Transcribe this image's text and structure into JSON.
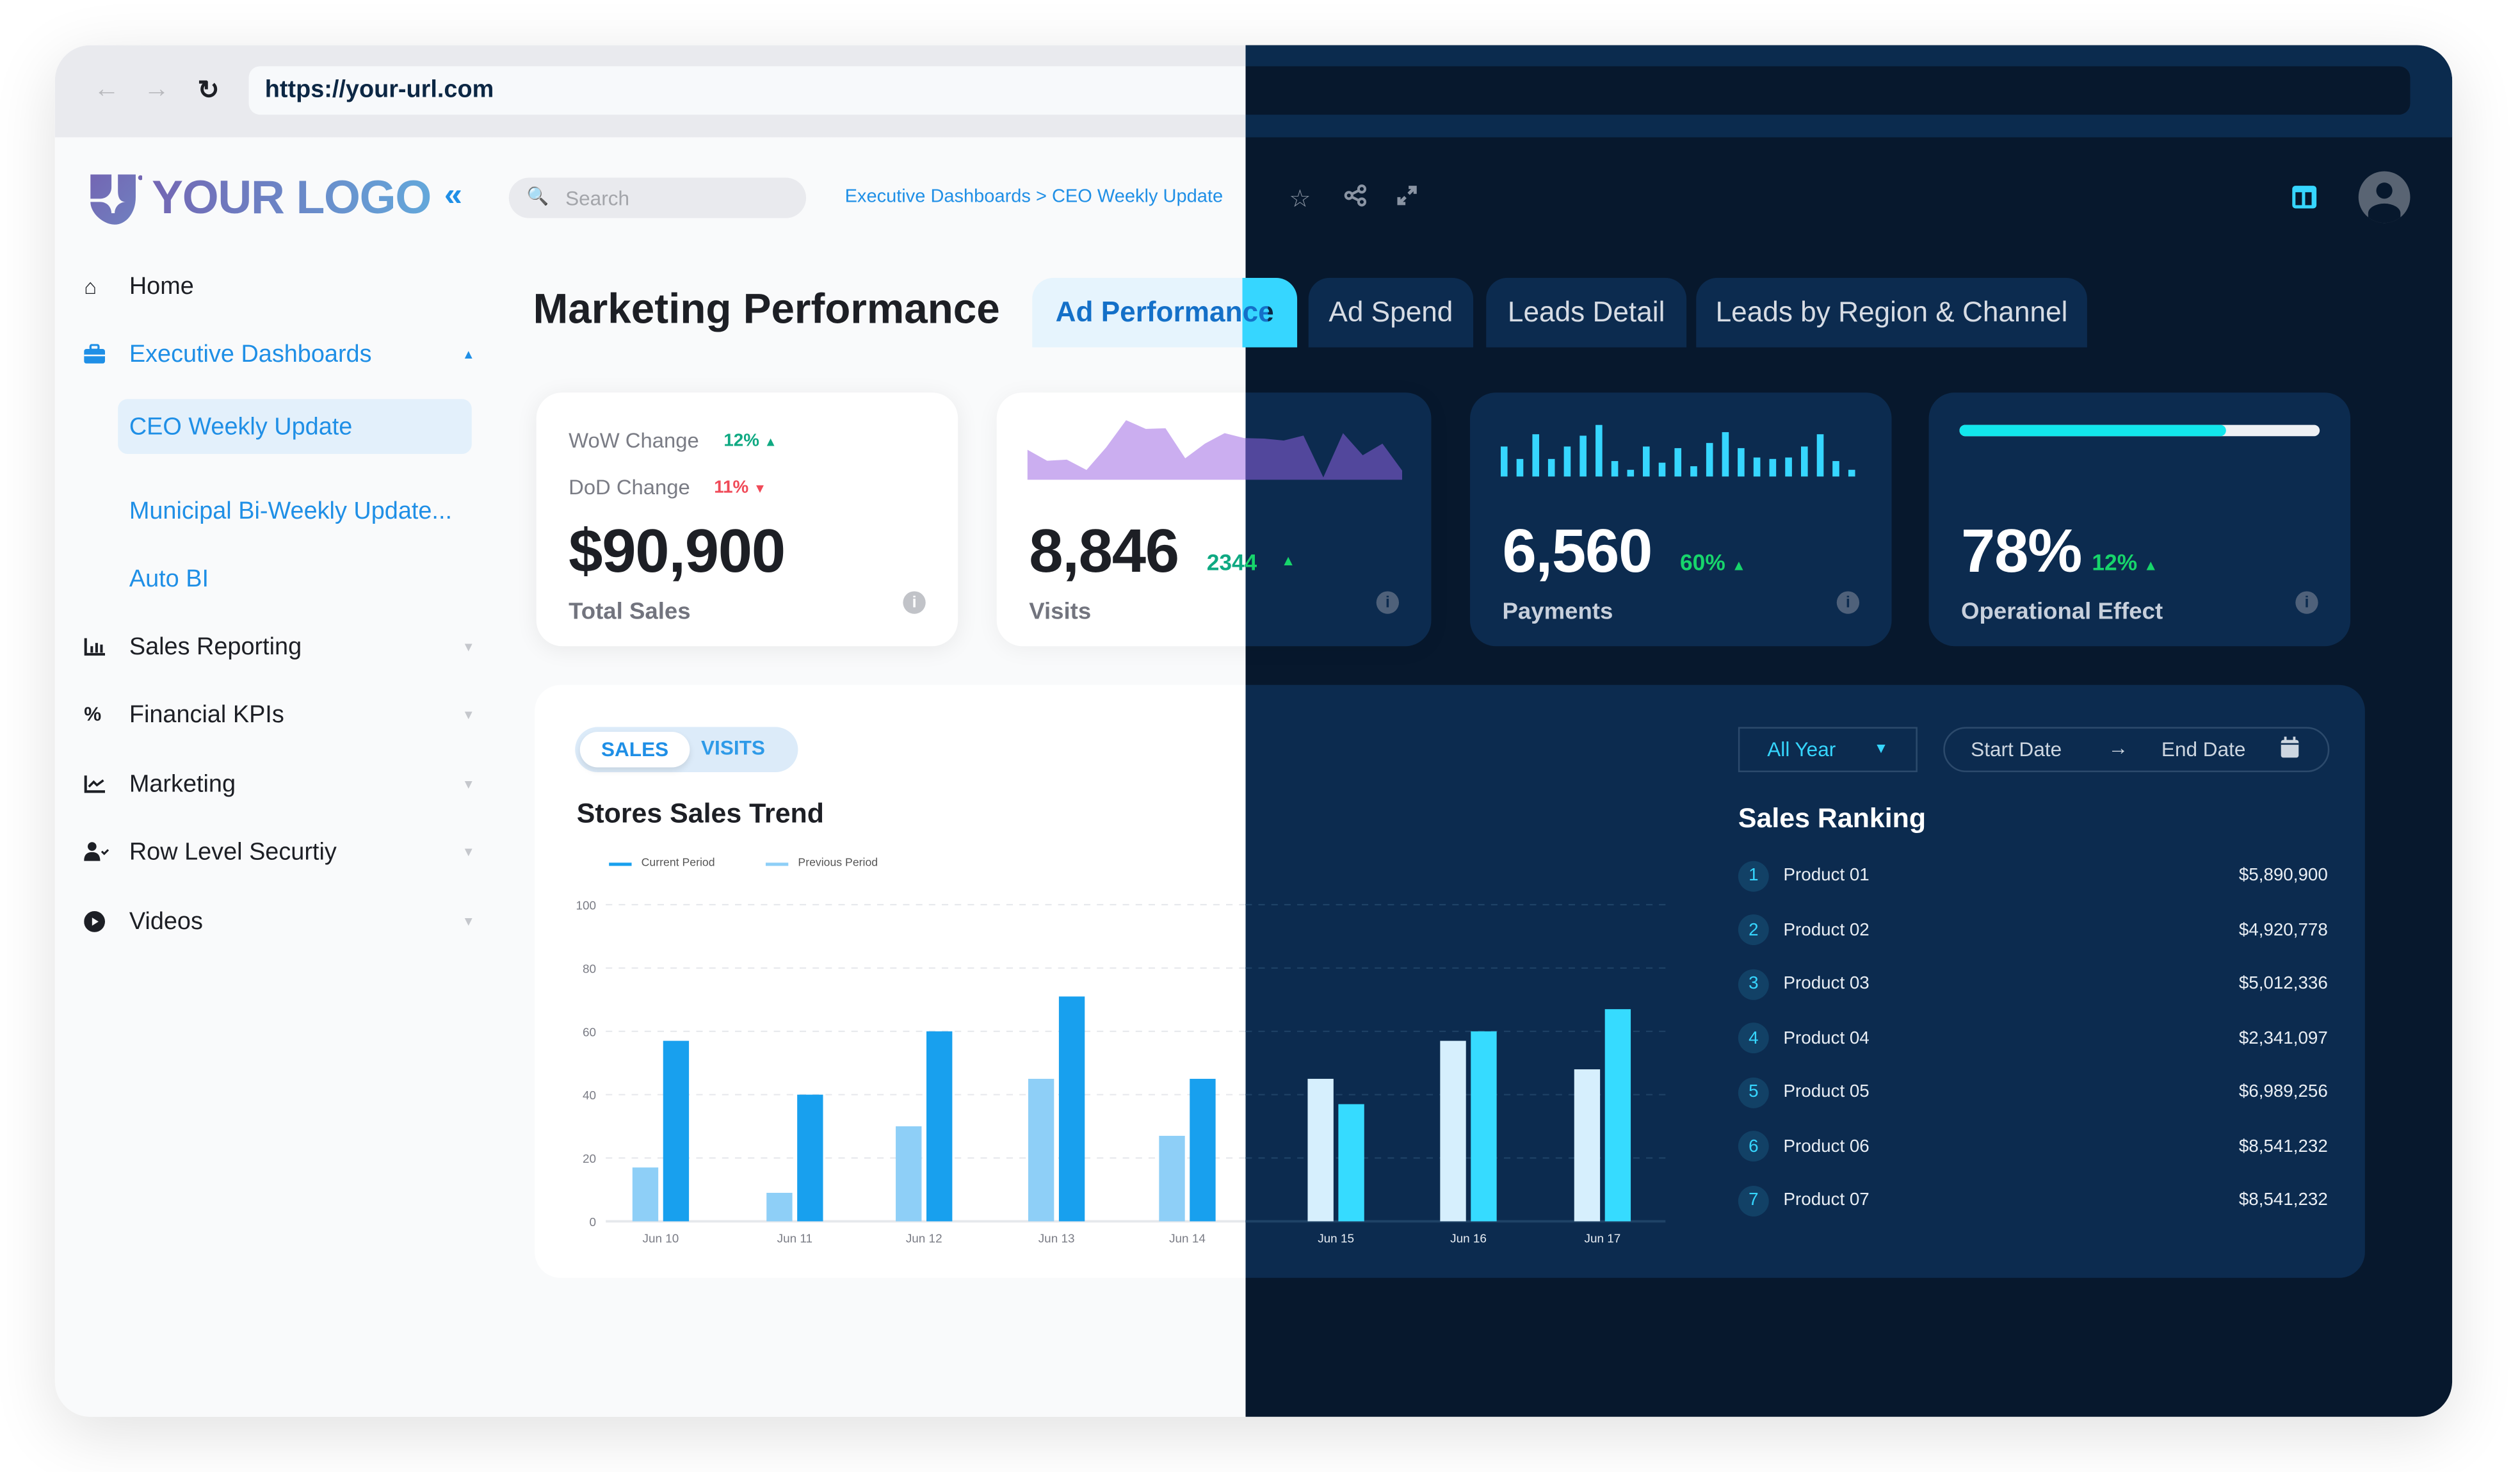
{
  "browser": {
    "url": "https://your-url.com",
    "icons": [
      "back-arrow-icon",
      "forward-arrow-icon",
      "reload-icon"
    ]
  },
  "header": {
    "logo_text": "YOUR LOGO",
    "collapse_glyph": "«",
    "search_placeholder": "Search",
    "breadcrumb": "Executive Dashboards > CEO Weekly Update",
    "icons": [
      "star-icon",
      "share-icon",
      "expand-icon",
      "layout-icon",
      "avatar-icon"
    ]
  },
  "sidebar": {
    "items": [
      {
        "label": "Home",
        "icon": "home-icon",
        "active": false,
        "caret": ""
      },
      {
        "label": "Executive Dashboards",
        "icon": "briefcase-icon",
        "active": true,
        "caret": "▲"
      },
      {
        "label": "Sales Reporting",
        "icon": "bar-chart-icon",
        "active": false,
        "caret": "▼"
      },
      {
        "label": "Financial KPIs",
        "icon": "percent-icon",
        "active": false,
        "caret": "▼"
      },
      {
        "label": "Marketing",
        "icon": "line-chart-icon",
        "active": false,
        "caret": "▼"
      },
      {
        "label": "Row Level Securtiy",
        "icon": "user-check-icon",
        "active": false,
        "caret": "▼"
      },
      {
        "label": "Videos",
        "icon": "play-circle-icon",
        "active": false,
        "caret": "▼"
      }
    ],
    "subitems": [
      {
        "label": "CEO Weekly Update",
        "selected": true
      },
      {
        "label": "Municipal Bi-Weekly Update...",
        "selected": false
      },
      {
        "label": "Auto BI",
        "selected": false
      }
    ]
  },
  "main": {
    "title": "Marketing Performance",
    "tabs": [
      {
        "label": "Ad Performance",
        "active": true
      },
      {
        "label": "Ad Spend",
        "active": false
      },
      {
        "label": "Leads Detail",
        "active": false
      },
      {
        "label": "Leads by Region & Channel",
        "active": false
      }
    ]
  },
  "kpis": {
    "total_sales": {
      "wow_label": "WoW Change",
      "wow_value": "12%",
      "wow_dir": "up",
      "dod_label": "DoD Change",
      "dod_value": "11%",
      "dod_dir": "down",
      "value": "$90,900",
      "label": "Total Sales"
    },
    "visits": {
      "value": "8,846",
      "delta": "2344",
      "delta_dir": "up",
      "label": "Visits",
      "sparkline": [
        49,
        31,
        33,
        16,
        53,
        97,
        83,
        84,
        35,
        59,
        76,
        68,
        67,
        64,
        72,
        4,
        76,
        40,
        59,
        15
      ]
    },
    "payments": {
      "value": "6,560",
      "delta": "60%",
      "delta_dir": "up",
      "label": "Payments",
      "bars": [
        58,
        34,
        82,
        34,
        58,
        79,
        100,
        30,
        13,
        58,
        27,
        55,
        20,
        65,
        86,
        55,
        37,
        34,
        37,
        58,
        82,
        30,
        13
      ]
    },
    "operational_effect": {
      "value": "78%",
      "delta": "12%",
      "delta_dir": "up",
      "label": "Operational Effect",
      "progress": 0.74
    }
  },
  "chart_panel": {
    "toggle": {
      "options": [
        "SALES",
        "VISITS"
      ],
      "selected": "SALES"
    },
    "filters": {
      "period": "All Year",
      "start_placeholder": "Start Date",
      "arrow": "→",
      "end_placeholder": "End Date"
    }
  },
  "chart_data": {
    "type": "bar",
    "title": "Stores Sales Trend",
    "categories": [
      "Jun 10",
      "Jun 11",
      "Jun 12",
      "Jun 13",
      "Jun 14",
      "Jun 15",
      "Jun 16",
      "Jun 17"
    ],
    "series": [
      {
        "name": "Previous Period",
        "values": [
          17,
          9,
          30,
          45,
          27,
          45,
          57,
          48
        ]
      },
      {
        "name": "Current Period",
        "values": [
          57,
          40,
          60,
          71,
          45,
          37,
          60,
          67
        ]
      }
    ],
    "legend": [
      "Current Period",
      "Previous Period"
    ],
    "legend_position": "top-left",
    "yticks": [
      0,
      20,
      40,
      60,
      80,
      100
    ],
    "ylim": [
      0,
      100
    ],
    "xlabel": "",
    "ylabel": "",
    "grid": true
  },
  "ranking": {
    "title": "Sales Ranking",
    "rows": [
      {
        "rank": "1",
        "name": "Product 01",
        "value": "$5,890,900"
      },
      {
        "rank": "2",
        "name": "Product 02",
        "value": "$4,920,778"
      },
      {
        "rank": "3",
        "name": "Product 03",
        "value": "$5,012,336"
      },
      {
        "rank": "4",
        "name": "Product 04",
        "value": "$2,341,097"
      },
      {
        "rank": "5",
        "name": "Product 05",
        "value": "$6,989,256"
      },
      {
        "rank": "6",
        "name": "Product 06",
        "value": "$8,541,232"
      },
      {
        "rank": "7",
        "name": "Product 07",
        "value": "$8,541,232"
      }
    ]
  },
  "colors": {
    "accent_blue": "#1f8fe6",
    "accent_cyan": "#36d6ff",
    "dark_bg": "#07182d",
    "dark_card": "#0c2b4f",
    "up_green": "#0fa982",
    "down_red": "#f04a58",
    "sparkline_light": "#cbaef0",
    "sparkline_dark": "#52479c",
    "bar_prev_light": "#8ecff7",
    "bar_cur_light": "#18a0ee",
    "bar_prev_dark": "#d6effd",
    "bar_cur_dark": "#36dbff"
  }
}
